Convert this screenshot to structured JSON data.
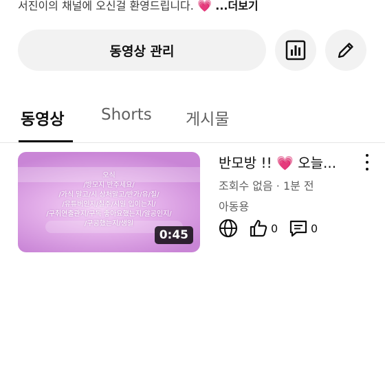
{
  "channel": {
    "description": "서진이의 채널에 오신걸 환영드립니다.",
    "description_emoji": "💗",
    "more_label": "...더보기"
  },
  "actions": {
    "manage_videos_label": "동영상 관리",
    "stats_icon": "bar-chart-icon",
    "edit_icon": "pencil-icon"
  },
  "tabs": [
    {
      "label": "동영상",
      "active": true
    },
    {
      "label": "Shorts",
      "active": false
    },
    {
      "label": "게시물",
      "active": false
    }
  ],
  "video": {
    "title_start": "반모방 !!",
    "title_emoji": "💗",
    "title_end": "오늘...",
    "meta": "조회수 없음 · 1분 전",
    "visibility": "아동용",
    "duration": "0:45",
    "thumbnail_lines": [
      "오식",
      "/방모지 반주세요/",
      "/가식 말고/시 상처말고/반가/유/질/",
      "/유튜버인지/칠주/시일 입이는지/",
      "/구취연출관지/구독 좋아요했는지/알공인지/",
      "/구공했는지/생일"
    ],
    "likes": "0",
    "comments": "0"
  },
  "colors": {
    "accent_pink": "#e0399a",
    "button_bg": "#f2f2f2",
    "thumbnail_tint": "#d99be4"
  }
}
